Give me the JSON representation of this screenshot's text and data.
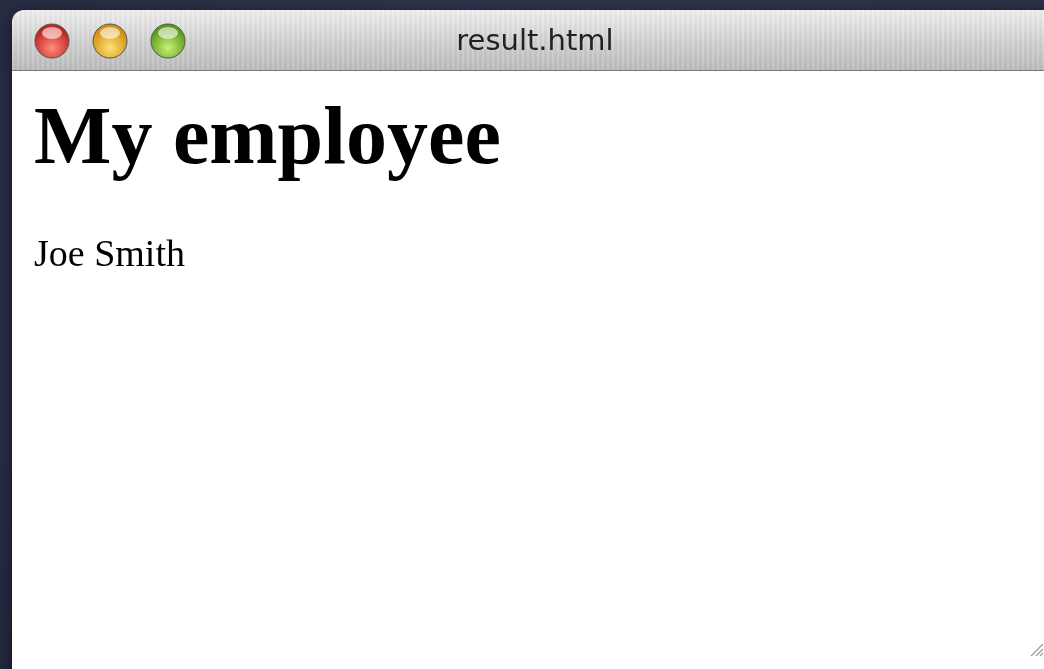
{
  "window": {
    "title": "result.html"
  },
  "content": {
    "heading": "My employee",
    "paragraph": "Joe Smith"
  }
}
